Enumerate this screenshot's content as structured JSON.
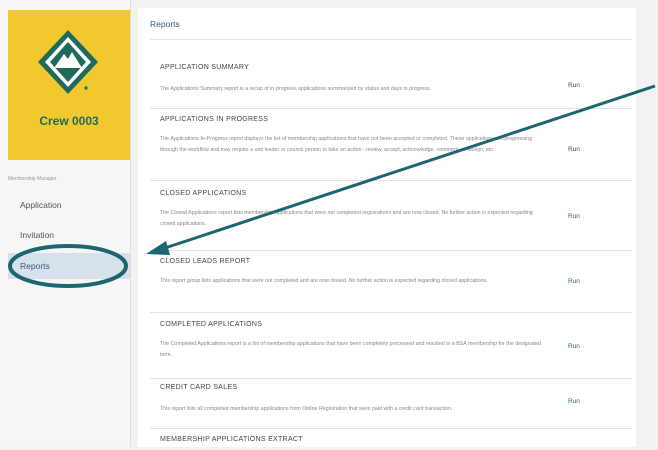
{
  "crew": {
    "name": "Crew 0003"
  },
  "sidebar": {
    "section_label": "Membership Manager",
    "items": [
      {
        "label": "Application"
      },
      {
        "label": "Invitation"
      },
      {
        "label": "Reports"
      }
    ]
  },
  "main": {
    "title": "Reports",
    "reports": [
      {
        "name": "APPLICATION SUMMARY",
        "description": "The Applications Summary report is a recap of in-progress applications summarized by status and days in progress.",
        "action": "Run"
      },
      {
        "name": "APPLICATIONS IN PROGRESS",
        "description": "The Applications In-Progress report displays the list of membership applications that have not been accepted or completed. These applications are progressing through the workflow and may require a unit leader or council person to take an action - review, accept, acknowledge, comment, re-assign, etc.",
        "action": "Run"
      },
      {
        "name": "CLOSED APPLICATIONS",
        "description": "The Closed Applications report lists membership applications that were not completed registrations and are now closed. No further action is expected regarding closed applications.",
        "action": "Run"
      },
      {
        "name": "CLOSED LEADS REPORT",
        "description": "This report group lists applications that were not completed and are now closed. No further action is expected regarding closed applications.",
        "action": "Run"
      },
      {
        "name": "COMPLETED APPLICATIONS",
        "description": "The Completed Applications report is a list of membership applications that have been completely processed and resulted in a BSA membership for the designated term.",
        "action": "Run"
      },
      {
        "name": "CREDIT CARD SALES",
        "description": "This report lists all completed membership applications from Online Registration that were paid with a credit card transaction.",
        "action": "Run"
      },
      {
        "name": "MEMBERSHIP APPLICATIONS EXTRACT",
        "description": "",
        "action": ""
      }
    ]
  },
  "colors": {
    "brand_yellow": "#f1c92e",
    "brand_green": "#1f6b5b",
    "link_blue": "#3a5a79",
    "annotation_teal": "#1b6670"
  }
}
